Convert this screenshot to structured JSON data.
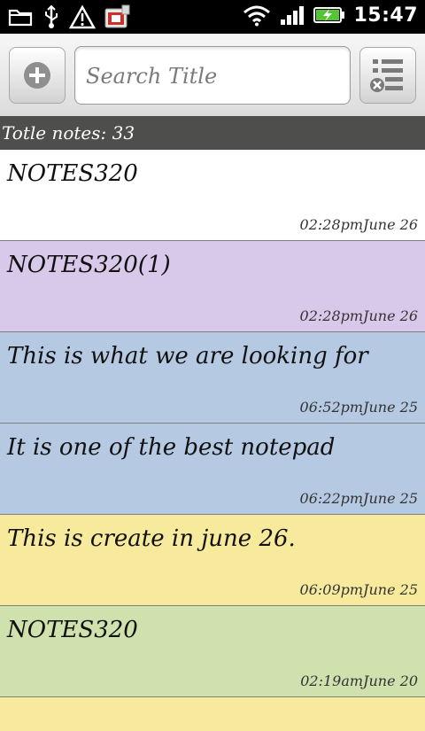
{
  "status_bar": {
    "time": "15:47",
    "left_icons": [
      "folder-icon",
      "usb-icon",
      "warning-icon",
      "calendar-app-icon"
    ],
    "right_icons": [
      "wifi-icon",
      "signal-icon",
      "battery-charging-icon"
    ]
  },
  "toolbar": {
    "add_icon": "plus-circle-icon",
    "search_placeholder": "Search Title",
    "menu_icon": "list-settings-icon"
  },
  "count_label": "Totle notes: 33",
  "notes": [
    {
      "title": "NOTES320",
      "time": "02:28pmJune 26",
      "color": "#ffffff"
    },
    {
      "title": "NOTES320(1)",
      "time": "02:28pmJune 26",
      "color": "#d8c8e9"
    },
    {
      "title": "This is what we are looking for",
      "time": "06:52pmJune 25",
      "color": "#b6c9e2"
    },
    {
      "title": "It is one of the best notepad",
      "time": "06:22pmJune 25",
      "color": "#b6c9e2"
    },
    {
      "title": "This is create in june 26.",
      "time": "06:09pmJune 25",
      "color": "#f7ea9c"
    },
    {
      "title": "NOTES320",
      "time": "02:19amJune 20",
      "color": "#cfe1ad"
    },
    {
      "title": "",
      "time": "",
      "color": "#f7ea9c"
    }
  ]
}
